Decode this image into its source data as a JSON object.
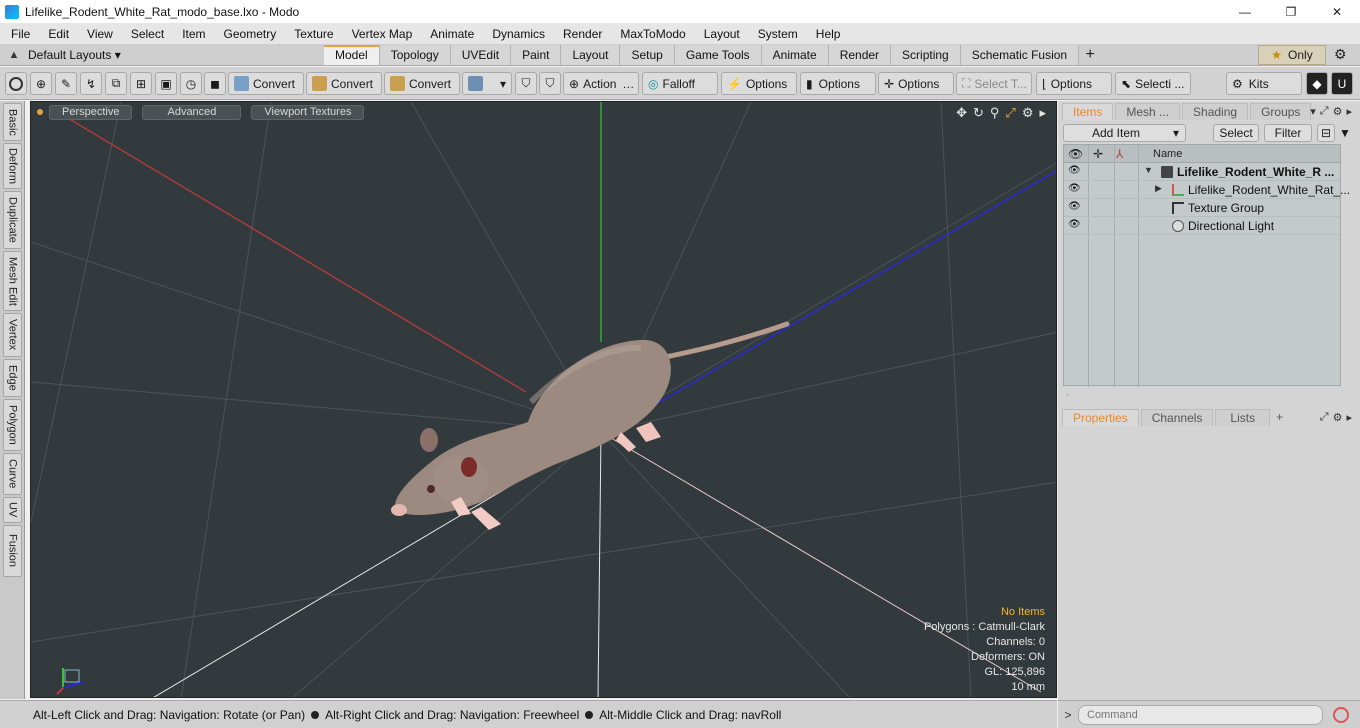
{
  "window": {
    "title": "Lifelike_Rodent_White_Rat_modo_base.lxo - Modo",
    "minimize": "—",
    "maximize": "❐",
    "close": "✕"
  },
  "menu": [
    "File",
    "Edit",
    "View",
    "Select",
    "Item",
    "Geometry",
    "Texture",
    "Vertex Map",
    "Animate",
    "Dynamics",
    "Render",
    "MaxToModo",
    "Layout",
    "System",
    "Help"
  ],
  "layouts": {
    "label": "Default Layouts ▾"
  },
  "mode_tabs": [
    {
      "label": "Model",
      "active": true
    },
    {
      "label": "Topology"
    },
    {
      "label": "UVEdit"
    },
    {
      "label": "Paint"
    },
    {
      "label": "Layout"
    },
    {
      "label": "Setup"
    },
    {
      "label": "Game Tools"
    },
    {
      "label": "Animate"
    },
    {
      "label": "Render"
    },
    {
      "label": "Scripting"
    },
    {
      "label": "Schematic Fusion"
    }
  ],
  "only": {
    "label": "Only"
  },
  "toolbar": {
    "convert1": "Convert",
    "convert2": "Convert",
    "convert3": "Convert",
    "action": "Action",
    "falloff": "Falloff",
    "options1": "Options",
    "options2": "Options",
    "options3": "Options",
    "select_t": "Select T...",
    "options4": "Options",
    "selecti": "Selecti ...",
    "kits": "Kits"
  },
  "left_rail": [
    "Basic",
    "Deform",
    "Duplicate",
    "Mesh Edit",
    "Vertex",
    "Edge",
    "Polygon",
    "Curve",
    "UV",
    "Fusion"
  ],
  "viewport": {
    "buttons": [
      "Perspective",
      "Advanced",
      "Viewport Textures"
    ],
    "info": {
      "selection": "No Items",
      "polygons": "Polygons : Catmull-Clark",
      "channels": "Channels: 0",
      "deformers": "Deformers: ON",
      "gl": "GL: 125,896",
      "unit": "10 mm"
    }
  },
  "status": {
    "hint1": "Alt-Left Click and Drag: Navigation: Rotate (or Pan)",
    "hint2": "Alt-Right Click and Drag: Navigation: Freewheel",
    "hint3": "Alt-Middle Click and Drag: navRoll"
  },
  "items_panel": {
    "tabs": [
      {
        "label": "Items",
        "active": true
      },
      {
        "label": "Mesh ..."
      },
      {
        "label": "Shading"
      },
      {
        "label": "Groups"
      }
    ],
    "add_item": "Add Item",
    "select": "Select",
    "filter": "Filter",
    "column_name": "Name",
    "rows": [
      {
        "label": "Lifelike_Rodent_White_R ...",
        "bold": true
      },
      {
        "label": "Lifelike_Rodent_White_Rat_..."
      },
      {
        "label": "Texture Group"
      },
      {
        "label": "Directional Light"
      }
    ]
  },
  "properties_panel": {
    "tabs": [
      {
        "label": "Properties",
        "active": true
      },
      {
        "label": "Channels"
      },
      {
        "label": "Lists"
      }
    ],
    "add": "+"
  },
  "command": {
    "placeholder": "Command",
    "caret": ">"
  },
  "colors": {
    "accent": "#e7a13a",
    "viewport_bg": "#333a3d",
    "x_axis": "#d23a3a",
    "y_axis": "#36c436",
    "z_axis": "#2a2ad4"
  }
}
